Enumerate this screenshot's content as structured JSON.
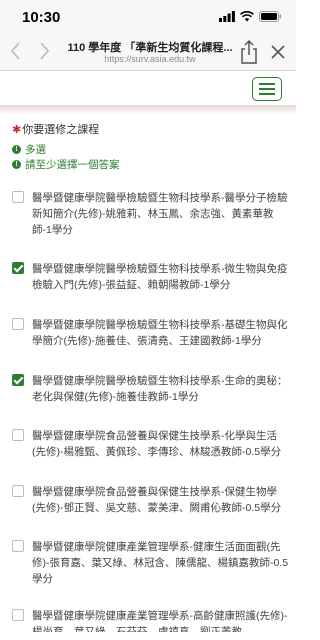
{
  "status": {
    "time": "10:30"
  },
  "browser": {
    "title": "110 學年度 「準新生均質化課程...",
    "url": "https://surv.asia.edu.tw"
  },
  "question": {
    "title": "你要選修之課程",
    "required_mark": "✱",
    "hints": [
      "多選",
      "請至少選擇一個答案"
    ]
  },
  "options": [
    {
      "label": "醫學暨健康學院醫學檢驗暨生物科技學系-醫學分子檢驗新知簡介(先修)-姚雅莉、林玉鳳、余志強、黃素華教師-1學分",
      "checked": false
    },
    {
      "label": "醫學暨健康學院醫學檢驗暨生物科技學系-微生物與免疫檢驗入門(先修)-張益鉦、賴朝陽教師-1學分",
      "checked": true
    },
    {
      "label": "醫學暨健康學院醫學檢驗暨生物科技學系-基礎生物與化學簡介(先修)-施養佳、張清堯、王建國教師-1學分",
      "checked": false
    },
    {
      "label": "醫學暨健康學院醫學檢驗暨生物科技學系-生命的奧秘：老化與保健(先修)-施養佳教師-1學分",
      "checked": true
    },
    {
      "label": "醫學暨健康學院食品營養與保健生技學系-化學與生活(先修)-楊雅甄、黃佩珍、李傳珍、林駿憑教師-0.5學分",
      "checked": false
    },
    {
      "label": "醫學暨健康學院食品營養與保健生技學系-保健生物學(先修)-鄧正賢、吳文慈、蒙美津、闕甫伈教師-0.5學分",
      "checked": false
    },
    {
      "label": "醫學暨健康學院健康產業管理學系-健康生活面面觀(先修)-張育嘉、葉又綠、林冠含、陳儒龍、楊鎮嘉教師-0.5學分",
      "checked": false
    },
    {
      "label": "醫學暨健康學院健康產業管理學系-高齡健康照護(先修)-楊尚育、葉又綠、石芬芬、盧禧真、劉正菁教",
      "checked": false
    }
  ]
}
